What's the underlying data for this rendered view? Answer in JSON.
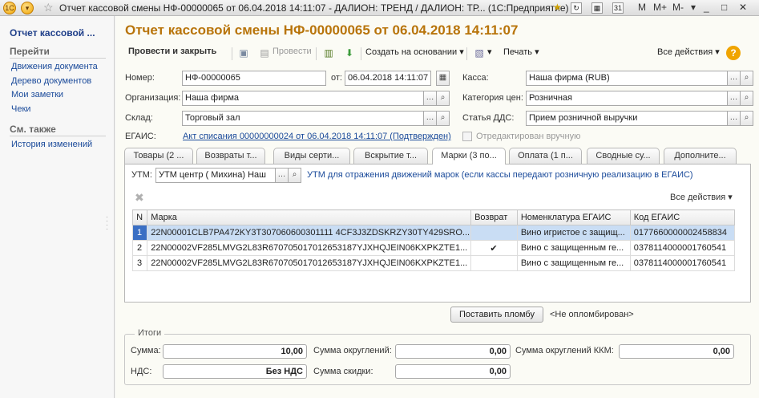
{
  "window": {
    "title": "Отчет кассовой смены НФ-00000065 от 06.04.2018 14:11:07 - ДАЛИОН: ТРЕНД / ДАЛИОН: ТР... (1С:Предприятие)",
    "right_labels": [
      "M",
      "M+",
      "M-"
    ]
  },
  "nav": {
    "current": "Отчет кассовой ...",
    "goto_title": "Перейти",
    "goto_links": [
      "Движения документа",
      "Дерево документов",
      "Мои заметки",
      "Чеки"
    ],
    "see_also_title": "См. также",
    "see_also_links": [
      "История изменений"
    ]
  },
  "doc": {
    "title": "Отчет кассовой смены НФ-00000065 от 06.04.2018 14:11:07"
  },
  "toolbar": {
    "post_and_close": "Провести и закрыть",
    "post": "Провести",
    "create_based": "Создать на основании",
    "print": "Печать",
    "all_actions": "Все действия"
  },
  "form": {
    "number_label": "Номер:",
    "number_value": "НФ-00000065",
    "date_label": "от:",
    "date_value": "06.04.2018 14:11:07",
    "org_label": "Организация:",
    "org_value": "Наша фирма",
    "warehouse_label": "Склад:",
    "warehouse_value": "Торговый зал",
    "egais_label": "ЕГАИС:",
    "egais_link": "Акт списания 00000000024 от 06.04.2018 14:11:07 (Подтвержден)",
    "cash_label": "Касса:",
    "cash_value": "Наша фирма (RUB)",
    "price_cat_label": "Категория цен:",
    "price_cat_value": "Розничная",
    "dds_label": "Статья ДДС:",
    "dds_value": "Прием розничной выручки",
    "edited_manually": "Отредактирован вручную"
  },
  "tabs": [
    {
      "label": "Товары (2 ..."
    },
    {
      "label": "Возвраты т..."
    },
    {
      "label": "Виды серти..."
    },
    {
      "label": "Вскрытие т..."
    },
    {
      "label": "Марки (3 по..."
    },
    {
      "label": "Оплата (1 п..."
    },
    {
      "label": "Сводные су..."
    },
    {
      "label": "Дополните..."
    }
  ],
  "marks_tab": {
    "utm_label": "УТМ:",
    "utm_value": "УТМ центр ( Михина) Наш",
    "utm_hint": "УТМ для отражения движений марок (если кассы передают розничную реализацию в ЕГАИС)",
    "all_actions": "Все действия",
    "columns": [
      "N",
      "Марка",
      "Возврат",
      "Номенклатура ЕГАИС",
      "Код ЕГАИС"
    ],
    "rows": [
      {
        "n": "1",
        "mark": "22N00001CLB7PA472KY3T307060600301111 4CF3J3ZDSKRZY30TY429SRO...",
        "ret": "",
        "nom": "Вино игристое с защищ...",
        "code": "0177660000002458834"
      },
      {
        "n": "2",
        "mark": "22N00002VF285LMVG2L83R670705017012653187YJXHQJEIN06KXPKZTE1...",
        "ret": "✔",
        "nom": "Вино с защищенным ге...",
        "code": "0378114000001760541"
      },
      {
        "n": "3",
        "mark": "22N00002VF285LMVG2L83R670705017012653187YJXHQJEIN06KXPKZTE1...",
        "ret": "",
        "nom": "Вино с защищенным ге...",
        "code": "0378114000001760541"
      }
    ]
  },
  "seal": {
    "button": "Поставить пломбу",
    "status": "<Не опломбирован>"
  },
  "totals": {
    "title": "Итоги",
    "sum_label": "Сумма:",
    "sum_value": "10,00",
    "rounding_label": "Сумма округлений:",
    "rounding_value": "0,00",
    "kkm_rounding_label": "Сумма округлений ККМ:",
    "kkm_rounding_value": "0,00",
    "vat_label": "НДС:",
    "vat_value": "Без НДС",
    "discount_label": "Сумма скидки:",
    "discount_value": "0,00"
  },
  "colors": {
    "title": "#b8740a",
    "link": "#1a4a9a",
    "selection": "#c9ddf4"
  }
}
